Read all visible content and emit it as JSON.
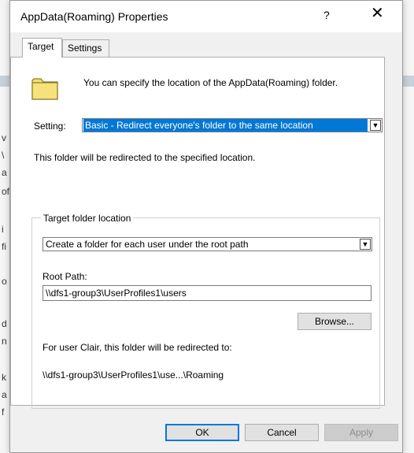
{
  "window": {
    "title": "AppData(Roaming) Properties",
    "help_label": "?",
    "close_label": "✕"
  },
  "tabs": [
    {
      "label": "Target",
      "active": true
    },
    {
      "label": "Settings",
      "active": false
    }
  ],
  "target": {
    "info_text": "You can specify the location of the AppData(Roaming) folder.",
    "setting_label": "Setting:",
    "setting_value": "Basic - Redirect everyone's folder to the same location",
    "redirect_text": "This folder will be redirected to the specified location.",
    "group_label": "Target folder location",
    "location_value": "Create a folder for each user under the root path",
    "root_path_label": "Root Path:",
    "root_path_value": "\\\\dfs1-group3\\UserProfiles1\\users",
    "browse_label": "Browse...",
    "user_text": "For user Clair, this folder will be redirected to:",
    "redirect_path": "\\\\dfs1-group3\\UserProfiles1\\use...\\Roaming"
  },
  "buttons": {
    "ok": "OK",
    "cancel": "Cancel",
    "apply": "Apply"
  },
  "background_chars": [
    "v",
    "\\",
    "a",
    "of",
    "i",
    "fi",
    "",
    "o",
    "",
    "d",
    "n",
    "k",
    "a",
    "f"
  ],
  "colors": {
    "selection": "#0078d7",
    "dialog_bg": "#f0f0f0"
  },
  "icons": {
    "folder": "folder-icon",
    "dropdown": "chevron-down-icon"
  }
}
